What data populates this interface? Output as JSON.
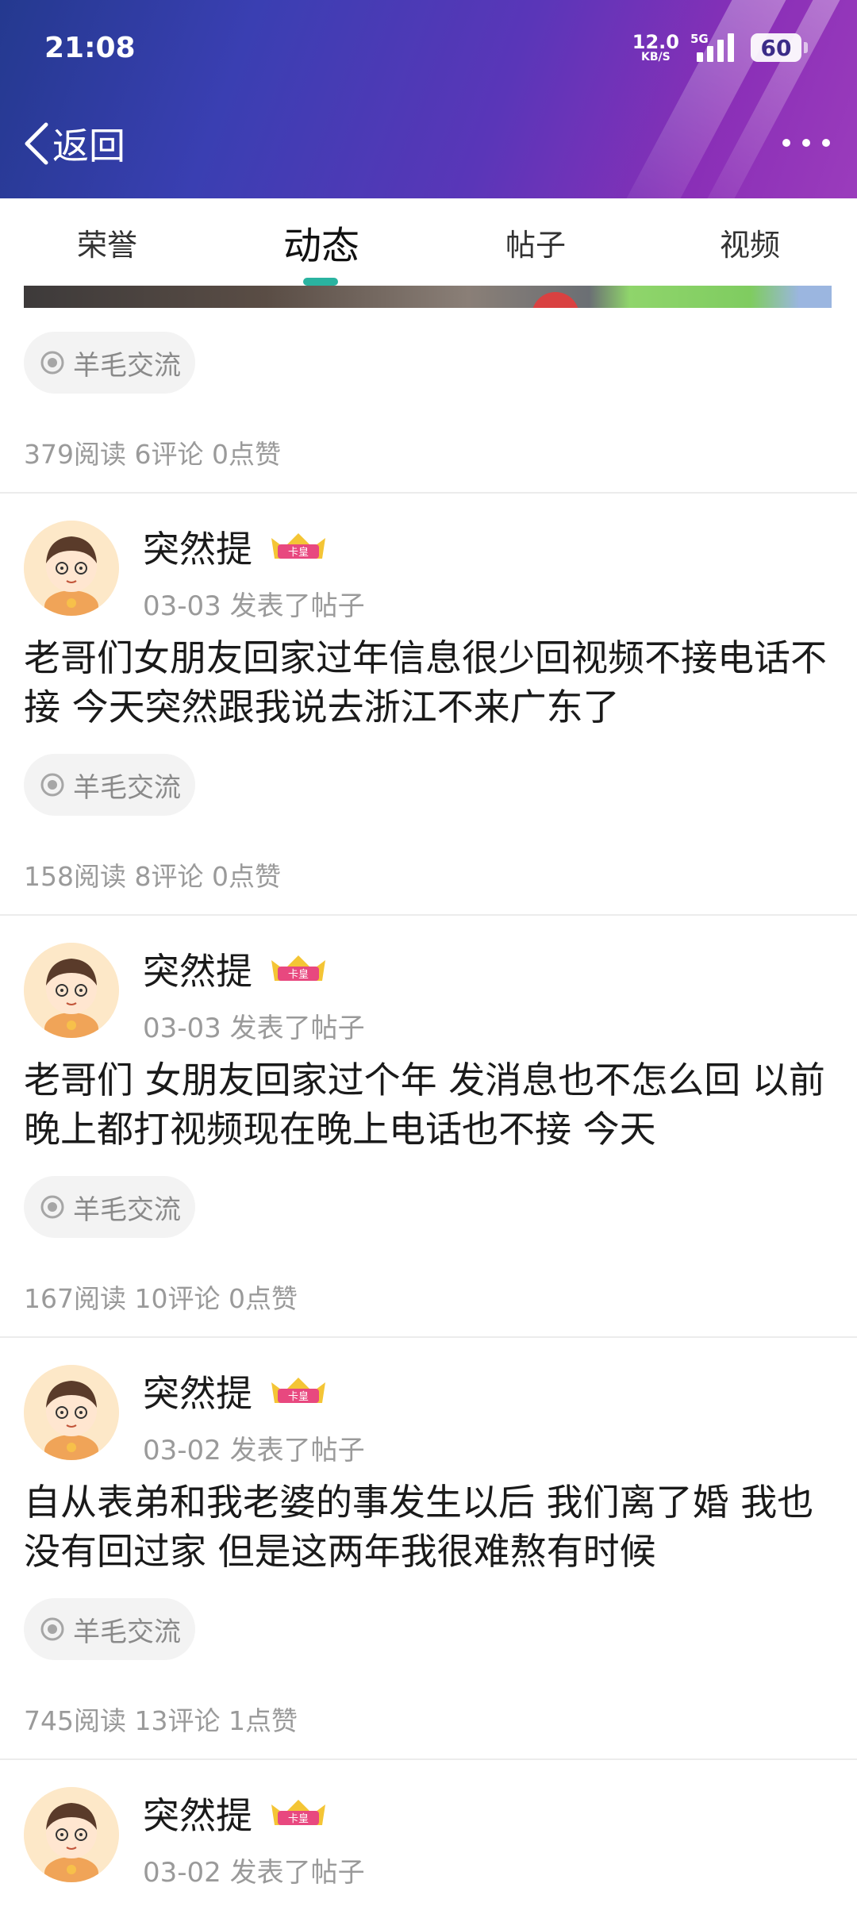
{
  "status_bar": {
    "time": "21:08",
    "net_speed": "12.0",
    "net_unit": "KB/S",
    "network": "5G",
    "battery": "60"
  },
  "header": {
    "back_label": "返回"
  },
  "tabs": [
    {
      "label": "荣誉",
      "active": false
    },
    {
      "label": "动态",
      "active": true
    },
    {
      "label": "帖子",
      "active": false
    },
    {
      "label": "视频",
      "active": false
    }
  ],
  "accent_color": "#2ab3a0",
  "top_item": {
    "topic": "羊毛交流",
    "stats": "379阅读 6评论 0点赞"
  },
  "posts": [
    {
      "username": "突然提",
      "badge": "卡皇",
      "meta": "03-03  发表了帖子",
      "content": "老哥们女朋友回家过年信息很少回视频不接电话不接 今天突然跟我说去浙江不来广东了",
      "topic": "羊毛交流",
      "stats": "158阅读 8评论 0点赞"
    },
    {
      "username": "突然提",
      "badge": "卡皇",
      "meta": "03-03  发表了帖子",
      "content": "老哥们 女朋友回家过个年 发消息也不怎么回 以前晚上都打视频现在晚上电话也不接 今天",
      "topic": "羊毛交流",
      "stats": "167阅读 10评论 0点赞"
    },
    {
      "username": "突然提",
      "badge": "卡皇",
      "meta": "03-02  发表了帖子",
      "content": "自从表弟和我老婆的事发生以后 我们离了婚 我也没有回过家 但是这两年我很难熬有时候",
      "topic": "羊毛交流",
      "stats": "745阅读 13评论 1点赞"
    },
    {
      "username": "突然提",
      "badge": "卡皇",
      "meta": "03-02  发表了帖子"
    }
  ]
}
